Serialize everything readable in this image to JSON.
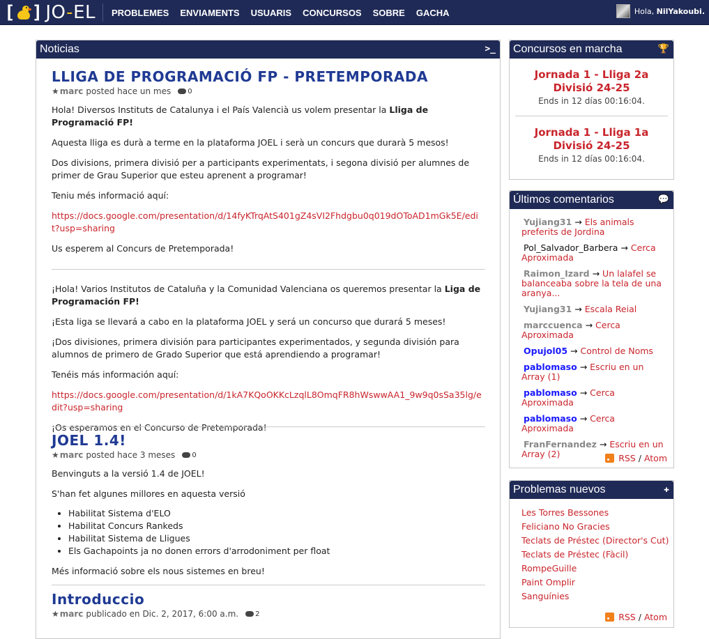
{
  "nav": {
    "logo_bracket_left": "[",
    "logo_bracket_right": "]",
    "logo_text": "JO",
    "logo_dash": "-",
    "logo_text2": "EL",
    "items": [
      "PROBLEMES",
      "ENVIAMENTS",
      "USUARIS",
      "CONCURSOS",
      "SOBRE",
      "GACHA"
    ],
    "greeting": "Hola,",
    "username": "NilYakoubi."
  },
  "news": {
    "header": "Noticias",
    "header_icon": ">_",
    "articles": [
      {
        "title": "LLIGA DE PROGRAMACIÓ FP - PRETEMPORADA",
        "author": "marc",
        "posted": "posted hace un mes",
        "comments": "0",
        "ca": {
          "p1_a": "Hola! Diversos Instituts de Catalunya i el País Valencià us volem presentar la ",
          "p1_b": "Lliga de Programació FP!",
          "p2": "Aquesta lliga es durà a terme en la plataforma JOEL i serà un concurs que durarà 5 mesos!",
          "p3": "Dos divisions, primera divisió per a participants experimentats, i segona divisió per alumnes de primer de Grau Superior que esteu aprenent a programar!",
          "p4": "Teniu més informació aquí:",
          "link": "https://docs.google.com/presentation/d/14fyKTrqAtS401gZ4sVI2Fhdgbu0q019dOToAD1mGk5E/edit?usp=sharing",
          "p5": "Us esperem al Concurs de Pretemporada!"
        },
        "es": {
          "p1_a": "¡Hola! Varios Institutos de Cataluña y la Comunidad Valenciana os queremos presentar la ",
          "p1_b": "Liga de Programación FP!",
          "p2": "¡Esta liga se llevará a cabo en la plataforma JOEL y será un concurso que durará 5 meses!",
          "p3": "¡Dos divisiones, primera división para participantes experimentados, y segunda división para alumnos de primero de Grado Superior que está aprendiendo a programar!",
          "p4": "Tenéis más información aquí:",
          "link": "https://docs.google.com/presentation/d/1kA7KQoOKKcLzqlL8OmqFR8hWswwAA1_9w9q0sSa35lg/edit?usp=sharing",
          "p5": "¡Os esperamos en el Concurso de Pretemporada!"
        }
      },
      {
        "title": "JOEL 1.4!",
        "author": "marc",
        "posted": "posted hace 3 meses",
        "comments": "0",
        "p1": "Benvinguts a la versió 1.4 de JOEL!",
        "p2": "S'han fet algunes millores en aquesta versió",
        "bullets": [
          "Habilitat Sistema d'ELO",
          "Habilitat Concurs Rankeds",
          "Habilitat Sistema de Lligues",
          "Els Gachapoints ja no donen errors d'arrodoniment per float"
        ],
        "p3": "Més informació sobre els nous sistemes en breu!"
      },
      {
        "title": "Introduccio",
        "author": "marc",
        "posted": "publicado en Dic. 2, 2017, 6:00 a.m.",
        "comments": "2"
      }
    ]
  },
  "contests": {
    "header": "Concursos en marcha",
    "items": [
      {
        "title": "Jornada 1 - Lliga 2a Divisió 24-25",
        "ends": "Ends in 12 días 00:16:04."
      },
      {
        "title": "Jornada 1 - Lliga 1a Divisió 24-25",
        "ends": "Ends in 12 días 00:16:04."
      }
    ]
  },
  "comments": {
    "header": "Últimos comentarios",
    "items": [
      {
        "user": "Yujiang31",
        "target": "Els animals preferits de Jordina"
      },
      {
        "user": "Pol_Salvador_Barbera",
        "target": "Cerca Aproximada"
      },
      {
        "user": "Raimon_Izard",
        "target": "Un lalafel se balanceaba sobre la tela de una aranya..."
      },
      {
        "user": "Yujiang31",
        "target": "Escala Reial"
      },
      {
        "user": "marccuenca",
        "target": "Cerca Aproximada"
      },
      {
        "user": "Opujol05",
        "target": "Control de Noms"
      },
      {
        "user": "pablomaso",
        "target": "Escriu en un Array (1)"
      },
      {
        "user": "pablomaso",
        "target": "Cerca Aproximada"
      },
      {
        "user": "pablomaso",
        "target": "Cerca Aproximada"
      },
      {
        "user": "FranFernandez",
        "target": "Escriu en un Array (2)"
      }
    ],
    "arrow": "→",
    "rss": "RSS",
    "sep": "/",
    "atom": "Atom"
  },
  "problems": {
    "header": "Problemas nuevos",
    "items": [
      "Les Torres Bessones",
      "Feliciano No Gracies",
      "Teclats de Préstec (Director's Cut)",
      "Teclats de Préstec (Fàcil)",
      "RompeGuille",
      "Paint Omplir",
      "Sanguínies"
    ],
    "rss": "RSS",
    "sep": "/",
    "atom": "Atom"
  },
  "colors": {
    "navbar": "#1f2a56",
    "title_blue": "#1f3a93",
    "link_red": "#c9252c",
    "user_blue": "#1a1aff",
    "user_gray": "#888888"
  }
}
